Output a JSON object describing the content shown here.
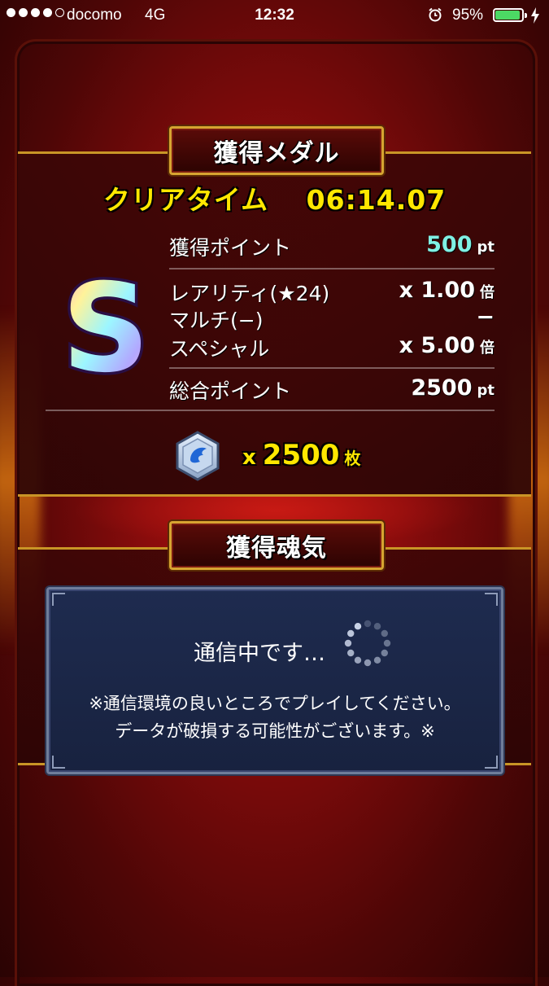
{
  "status_bar": {
    "carrier": "docomo",
    "network": "4G",
    "time": "12:32",
    "battery_percent": "95%",
    "battery_level": 0.95,
    "signal_bars_filled": 4,
    "signal_bars_total": 5
  },
  "medal_section": {
    "title": "獲得メダル",
    "clear_time_label": "クリアタイム",
    "clear_time_value": "06:14.07",
    "rank": "S",
    "earned_points": {
      "label": "獲得ポイント",
      "value": "500",
      "unit": "pt"
    },
    "rarity": {
      "label": "レアリティ(★24)",
      "value": "x 1.00",
      "unit": "倍"
    },
    "multi": {
      "label": "マルチ(−)",
      "value": "−"
    },
    "special": {
      "label": "スペシャル",
      "value": "x 5.00",
      "unit": "倍"
    },
    "total_points": {
      "label": "総合ポイント",
      "value": "2500",
      "unit": "pt"
    },
    "medal_count": {
      "prefix": "x",
      "value": "2500",
      "unit": "枚"
    }
  },
  "soul_section": {
    "title": "獲得魂気"
  },
  "dialog": {
    "message": "通信中です…",
    "warning_line1": "※通信環境の良いところでプレイしてください。",
    "warning_line2": "データが破損する可能性がございます。※"
  },
  "colors": {
    "background": "#8a0c0c",
    "gold_border": "#c99526",
    "yellow_text": "#ffe700",
    "cyan_text": "#7ff0e4",
    "dialog_bg": "#1e2b4f",
    "battery_green": "#4cd964"
  }
}
